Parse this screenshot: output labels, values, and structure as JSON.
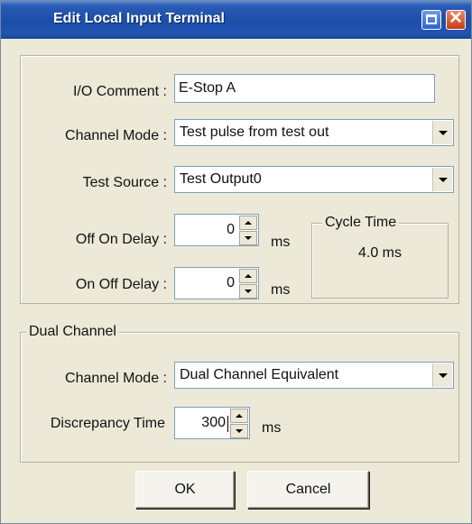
{
  "window": {
    "title": "Edit Local Input Terminal",
    "icons": {
      "maximize": "maximize-icon",
      "close": "close-icon"
    }
  },
  "io_comment": {
    "label": "I/O Comment :",
    "value": "E-Stop A"
  },
  "channel_mode": {
    "label": "Channel Mode :",
    "selected": "Test pulse from test out"
  },
  "test_source": {
    "label": "Test Source :",
    "selected": "Test Output0"
  },
  "off_on_delay": {
    "label": "Off On Delay :",
    "value": "0",
    "unit": "ms"
  },
  "on_off_delay": {
    "label": "On Off Delay :",
    "value": "0",
    "unit": "ms"
  },
  "cycle_time": {
    "legend": "Cycle Time",
    "value": "4.0 ms"
  },
  "dual_channel": {
    "legend": "Dual Channel",
    "channel_mode": {
      "label": "Channel Mode :",
      "selected": "Dual Channel Equivalent"
    },
    "discrepancy_time": {
      "label": "Discrepancy Time",
      "value": "300",
      "unit": "ms"
    }
  },
  "buttons": {
    "ok": "OK",
    "cancel": "Cancel"
  },
  "colors": {
    "titlebar": "#1c4ea8",
    "dialog_bg": "#ece9d8",
    "close_button": "#c53d14"
  }
}
